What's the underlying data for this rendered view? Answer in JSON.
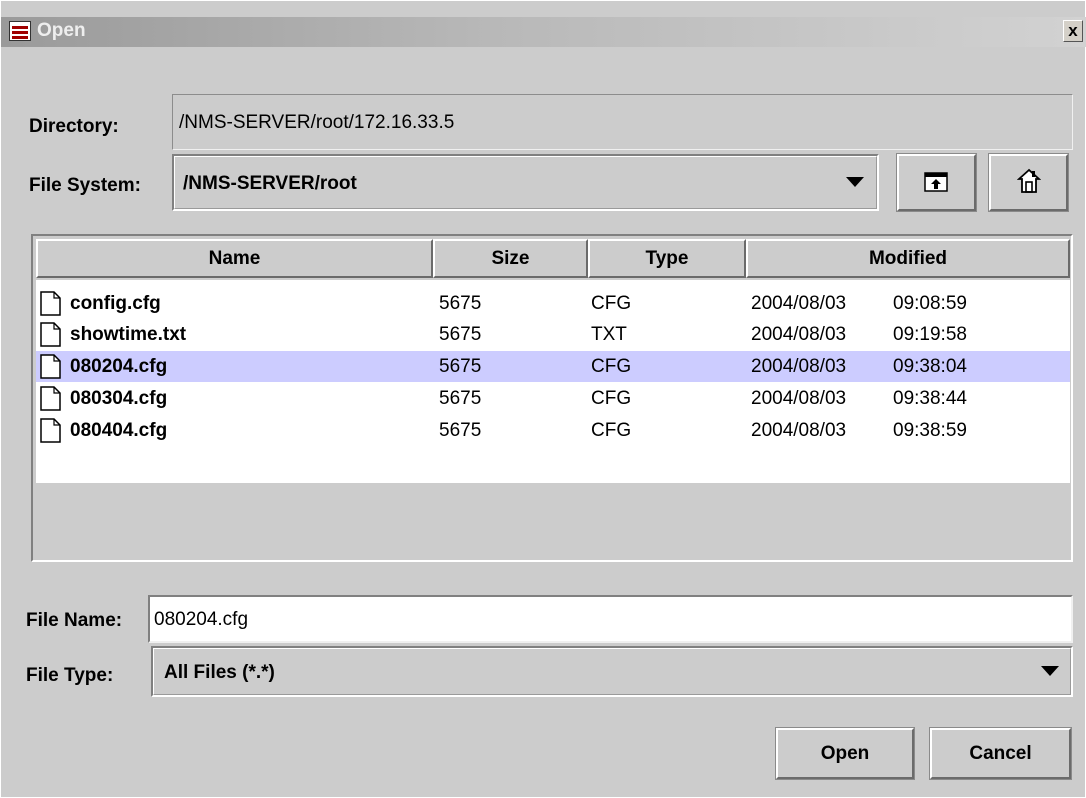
{
  "window": {
    "title": "Open",
    "close_label": "x"
  },
  "directory": {
    "label": "Directory:",
    "value": "/NMS-SERVER/root/172.16.33.5"
  },
  "file_system": {
    "label": "File System:",
    "value": "/NMS-SERVER/root",
    "up_icon": "up-folder-icon",
    "home_icon": "home-icon"
  },
  "table": {
    "headers": {
      "name": "Name",
      "size": "Size",
      "type": "Type",
      "modified": "Modified"
    },
    "rows": [
      {
        "name": "config.cfg",
        "size": "5675",
        "type": "CFG",
        "date": "2004/08/03",
        "time": "09:08:59"
      },
      {
        "name": "showtime.txt",
        "size": "5675",
        "type": "TXT",
        "date": "2004/08/03",
        "time": "09:19:58"
      },
      {
        "name": "080204.cfg",
        "size": "5675",
        "type": "CFG",
        "date": "2004/08/03",
        "time": "09:38:04"
      },
      {
        "name": "080304.cfg",
        "size": "5675",
        "type": "CFG",
        "date": "2004/08/03",
        "time": "09:38:44"
      },
      {
        "name": "080404.cfg",
        "size": "5675",
        "type": "CFG",
        "date": "2004/08/03",
        "time": "09:38:59"
      }
    ],
    "selected_index": 2,
    "selection_color": "#ccccff"
  },
  "file_name": {
    "label": "File Name:",
    "value": "080204.cfg"
  },
  "file_type": {
    "label": "File Type:",
    "value": "All Files (*.*)"
  },
  "buttons": {
    "open": "Open",
    "cancel": "Cancel"
  }
}
